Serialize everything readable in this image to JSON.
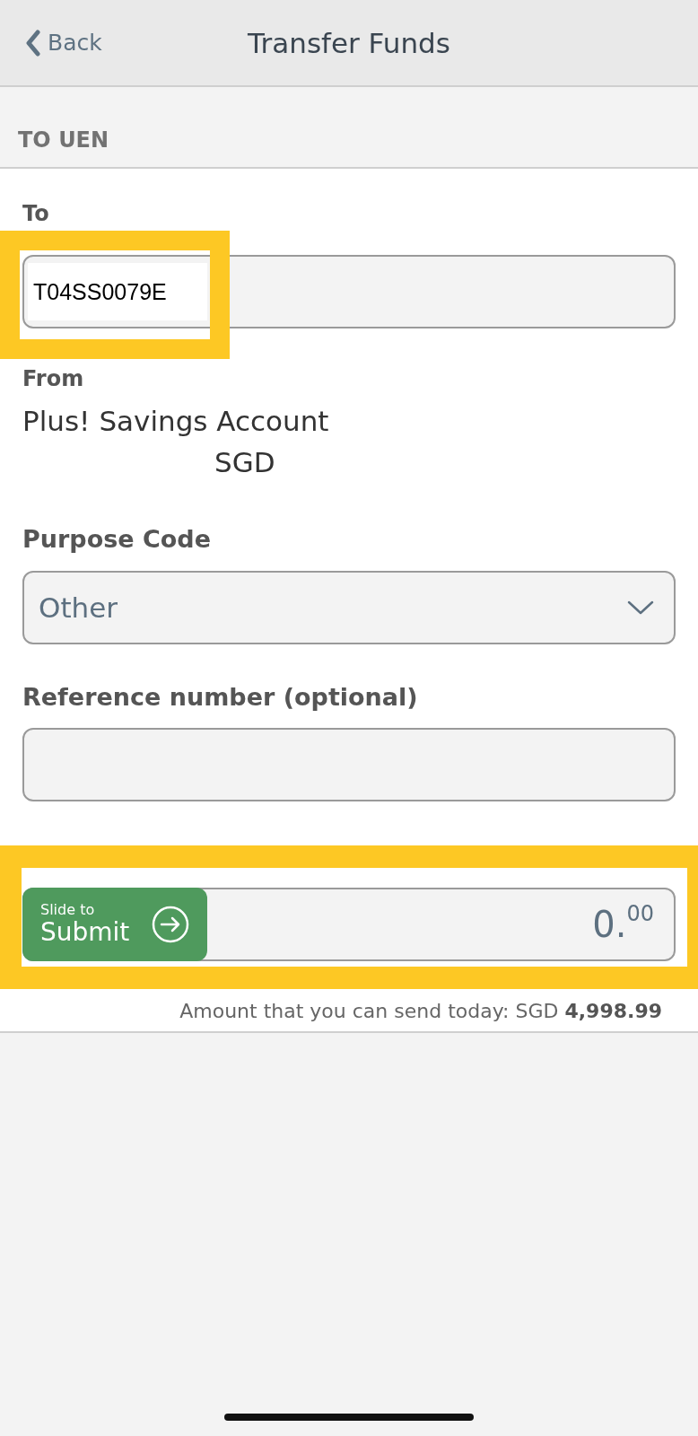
{
  "header": {
    "back_label": "Back",
    "title": "Transfer Funds"
  },
  "section": {
    "title": "TO UEN"
  },
  "form": {
    "to": {
      "label": "To",
      "value": "T04SS0079E",
      "highlighted": true
    },
    "from": {
      "label": "From",
      "account_name": "Plus! Savings Account",
      "currency": "SGD"
    },
    "purpose_code": {
      "label": "Purpose Code",
      "value": "Other"
    },
    "reference": {
      "label": "Reference number (optional)"
    }
  },
  "slider": {
    "hint": "Slide to",
    "action": "Submit",
    "level": 0,
    "amount": "0.$^{00}$",
    "highlighted": true
  },
  "limit_note": "Amount that you can send today: SGD **4,998.99**"
}
